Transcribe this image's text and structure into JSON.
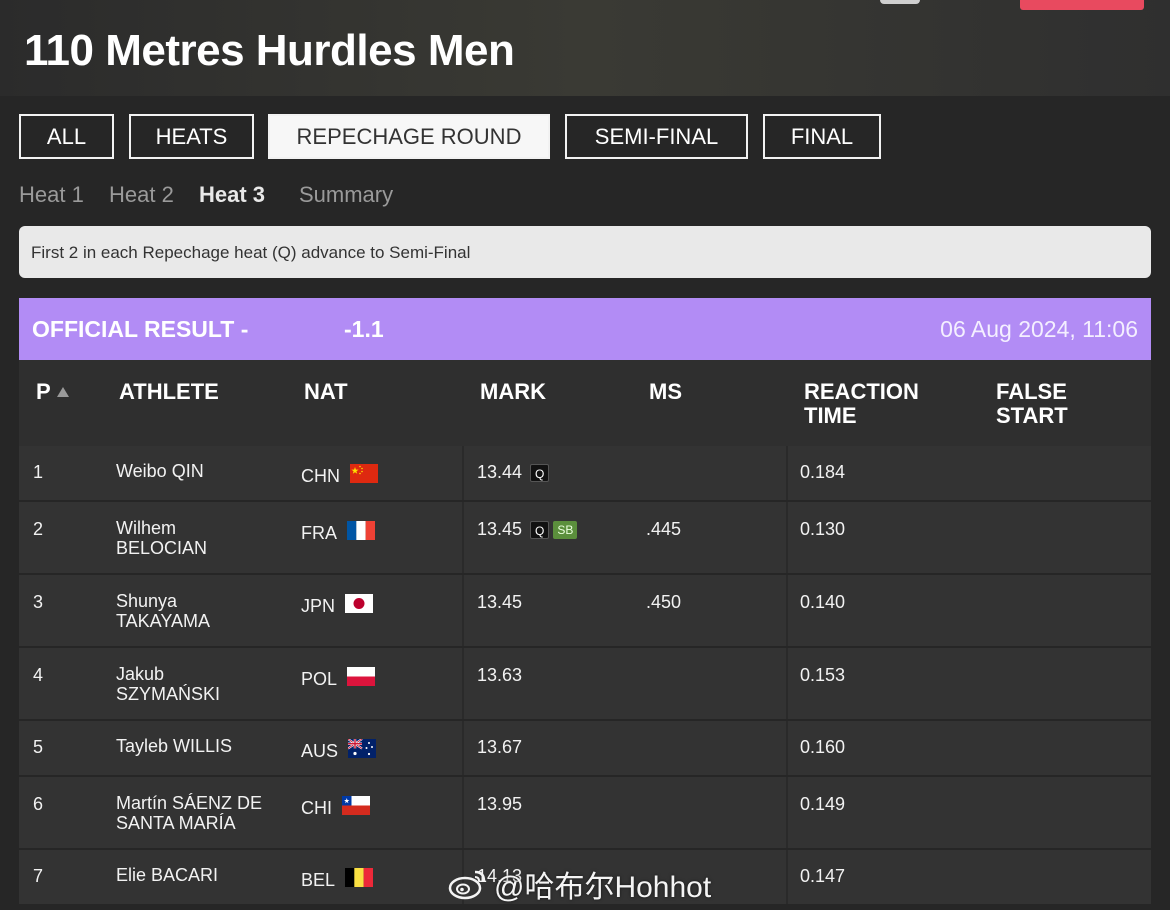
{
  "header": {
    "title": "110 Metres Hurdles Men"
  },
  "rounds": [
    {
      "label": "ALL",
      "active": false
    },
    {
      "label": "HEATS",
      "active": false
    },
    {
      "label": "REPECHAGE ROUND",
      "active": true
    },
    {
      "label": "SEMI-FINAL",
      "active": false
    },
    {
      "label": "FINAL",
      "active": false
    }
  ],
  "heats": [
    {
      "label": "Heat 1",
      "active": false
    },
    {
      "label": "Heat 2",
      "active": false
    },
    {
      "label": "Heat 3",
      "active": true
    },
    {
      "label": "Summary",
      "active": false
    }
  ],
  "notice": "First 2 in each Repechage heat (Q) advance to Semi-Final",
  "result": {
    "label": "OFFICIAL RESULT -",
    "wind": "-1.1",
    "datetime": "06 Aug 2024, 11:06"
  },
  "columns": {
    "pos": "P",
    "athlete": "ATHLETE",
    "nat": "NAT",
    "mark": "MARK",
    "ms": "MS",
    "reaction": "REACTION\nTIME",
    "false_start": "FALSE\nSTART"
  },
  "rows": [
    {
      "pos": "1",
      "athlete": "Weibo QIN",
      "nat": "CHN",
      "flag": "china-flag-icon",
      "mark": "13.44",
      "q": "Q",
      "sb": "",
      "ms": "",
      "rt": "0.184"
    },
    {
      "pos": "2",
      "athlete": "Wilhem\nBELOCIAN",
      "nat": "FRA",
      "flag": "france-flag-icon",
      "mark": "13.45",
      "q": "Q",
      "sb": "SB",
      "ms": ".445",
      "rt": "0.130"
    },
    {
      "pos": "3",
      "athlete": "Shunya\nTAKAYAMA",
      "nat": "JPN",
      "flag": "japan-flag-icon",
      "mark": "13.45",
      "q": "",
      "sb": "",
      "ms": ".450",
      "rt": "0.140"
    },
    {
      "pos": "4",
      "athlete": "Jakub\nSZYMAŃSKI",
      "nat": "POL",
      "flag": "poland-flag-icon",
      "mark": "13.63",
      "q": "",
      "sb": "",
      "ms": "",
      "rt": "0.153"
    },
    {
      "pos": "5",
      "athlete": "Tayleb WILLIS",
      "nat": "AUS",
      "flag": "australia-flag-icon",
      "mark": "13.67",
      "q": "",
      "sb": "",
      "ms": "",
      "rt": "0.160"
    },
    {
      "pos": "6",
      "athlete": "Martín SÁENZ DE\nSANTA MARÍA",
      "nat": "CHI",
      "flag": "chile-flag-icon",
      "mark": "13.95",
      "q": "",
      "sb": "",
      "ms": "",
      "rt": "0.149"
    },
    {
      "pos": "7",
      "athlete": "Elie BACARI",
      "nat": "BEL",
      "flag": "belgium-flag-icon",
      "mark": "14.13",
      "q": "",
      "sb": "",
      "ms": "",
      "rt": "0.147"
    }
  ],
  "watermark": "@哈布尔Hohhot",
  "colors": {
    "accent": "#b28cf5",
    "brand_red": "#e84a5f",
    "sb_green": "#5b8f3c"
  }
}
